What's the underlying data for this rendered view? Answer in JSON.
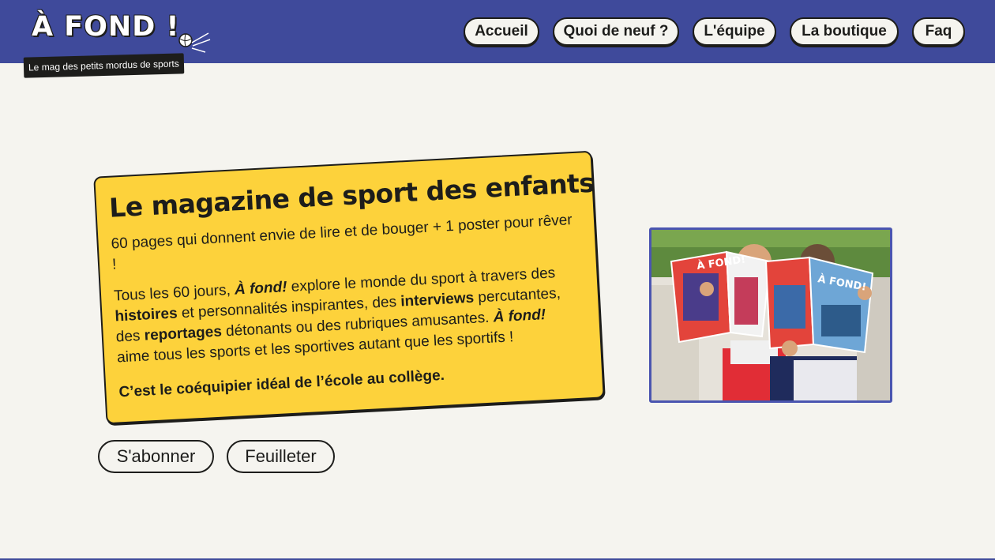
{
  "brand": {
    "logo_text": "À FOND !",
    "tagline": "Le mag des petits mordus de sports"
  },
  "nav": {
    "items": [
      {
        "label": "Accueil"
      },
      {
        "label": "Quoi de neuf ?"
      },
      {
        "label": "L'équipe"
      },
      {
        "label": "La boutique"
      },
      {
        "label": "Faq"
      }
    ]
  },
  "hero": {
    "title": "Le magazine de sport des enfants",
    "intro": "60 pages qui donnent envie de lire et de bouger + 1 poster pour rêver !",
    "body": {
      "t1": "Tous les 60 jours, ",
      "brand1": "À fond!",
      "t2": " explore le monde du sport à travers des ",
      "b1": "histoires",
      "t3": " et personnalités inspirantes, des ",
      "b2": "interviews",
      "t4": " percutantes, des ",
      "b3": "reportages",
      "t5": " détonants ou des rubriques amusantes. ",
      "brand2": "À fond!",
      "t6": " aime tous les sports et les sportives autant que les sportifs !"
    },
    "closing": "C’est le coéquipier idéal de l’école au collège.",
    "buttons": {
      "subscribe": "S'abonner",
      "browse": "Feuilleter"
    }
  },
  "photo": {
    "magazine_left_title": "À FOND!",
    "magazine_right_title": "À FOND!"
  },
  "colors": {
    "header_bg": "#3f4a9b",
    "card_bg": "#fdd23b",
    "page_bg": "#f5f4ef",
    "ink": "#1d1d1b",
    "photo_border": "#4a55b0"
  }
}
